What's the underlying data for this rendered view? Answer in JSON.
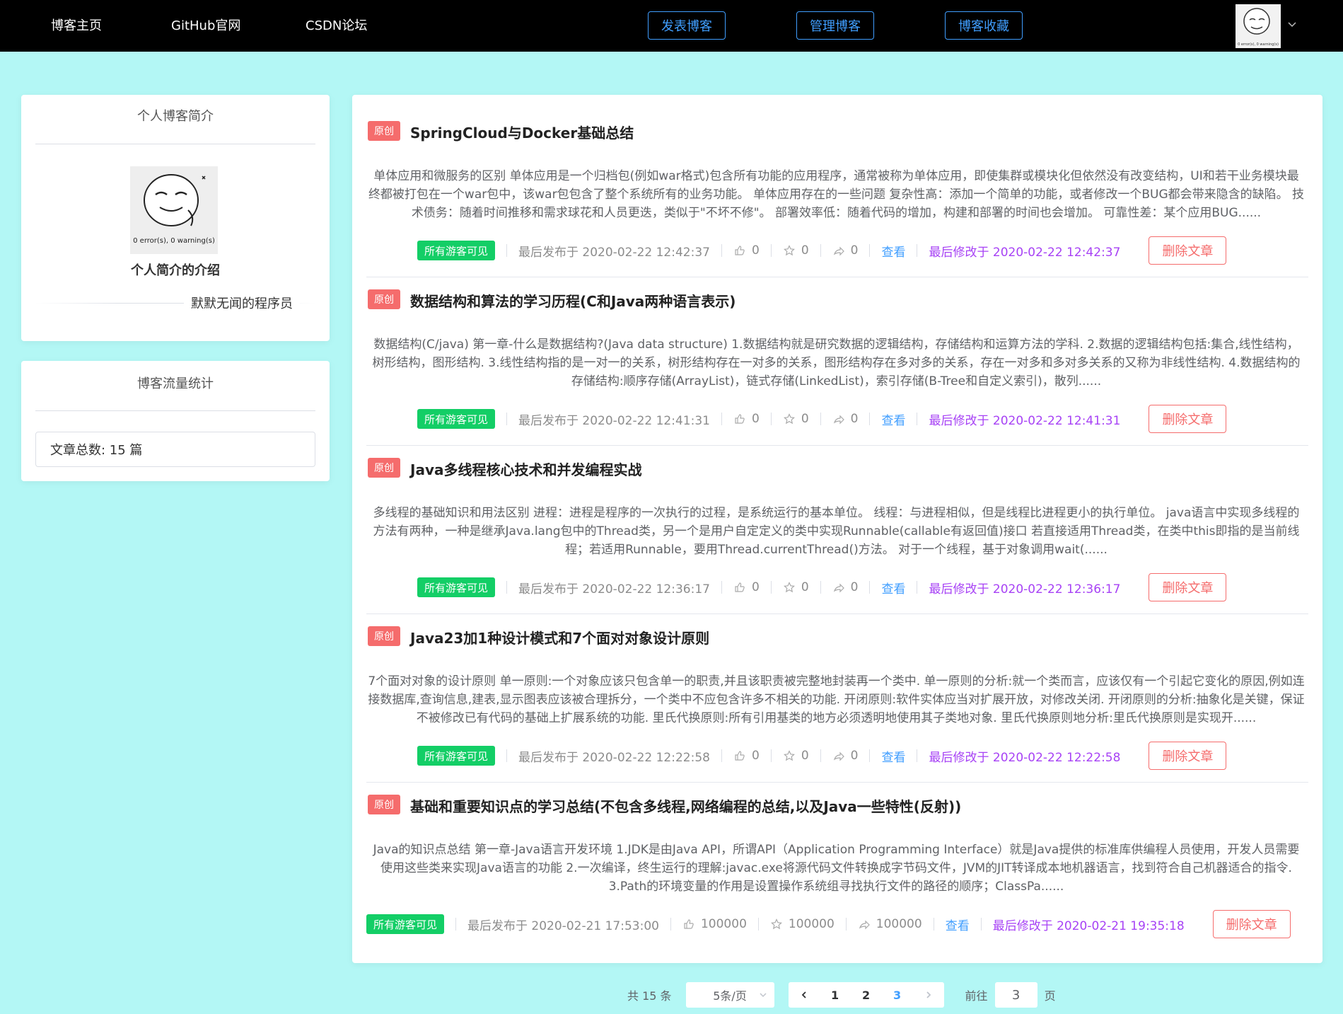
{
  "nav": {
    "home": "博客主页",
    "github": "GitHub官网",
    "csdn": "CSDN论坛",
    "publish": "发表博客",
    "manage": "管理博客",
    "favorites": "博客收藏"
  },
  "sidebar": {
    "profile_title": "个人博客简介",
    "avatar_caption": "0 error(s), 0 warning(s)",
    "profile_heading": "个人简介的介绍",
    "profile_name": "默默无闻的程序员",
    "stats_title": "博客流量统计",
    "article_count": "文章总数: 15 篇"
  },
  "articles": [
    {
      "badge": "原创",
      "title": "SpringCloud与Docker基础总结",
      "summary": "单体应用和微服务的区别 单体应用是一个归档包(例如war格式)包含所有功能的应用程序，通常被称为单体应用，即使集群或模块化但依然没有改变结构，UI和若干业务模块最终都被打包在一个war包中，该war包包含了整个系统所有的业务功能。 单体应用存在的一些问题 复杂性高：添加一个简单的功能，或者修改一个BUG都会带来隐含的缺陷。 技术债务：随着时间推移和需求球花和人员更迭，类似于\"不坏不修\"。 部署效率低：随着代码的增加，构建和部署的时间也会增加。 可靠性差：某个应用BUG......",
      "visibility": "所有游客可见",
      "published": "最后发布于 2020-02-22 12:42:37",
      "likes": "0",
      "stars": "0",
      "shares": "0",
      "view": "查看",
      "modified": "最后修改于 2020-02-22 12:42:37",
      "delete": "删除文章"
    },
    {
      "badge": "原创",
      "title": "数据结构和算法的学习历程(C和Java两种语言表示)",
      "summary": "数据结构(C/java) 第一章-什么是数据结构?(Java data structure) 1.数据结构就是研究数据的逻辑结构，存储结构和运算方法的学科. 2.数据的逻辑结构包括:集合,线性结构，树形结构，图形结构. 3.线性结构指的是一对一的关系，树形结构存在一对多的关系，图形结构存在多对多的关系，存在一对多和多对多关系的又称为非线性结构. 4.数据结构的存储结构:顺序存储(ArrayList)，链式存储(LinkedList)，索引存储(B-Tree和自定义索引)，散列......",
      "visibility": "所有游客可见",
      "published": "最后发布于 2020-02-22 12:41:31",
      "likes": "0",
      "stars": "0",
      "shares": "0",
      "view": "查看",
      "modified": "最后修改于 2020-02-22 12:41:31",
      "delete": "删除文章"
    },
    {
      "badge": "原创",
      "title": "Java多线程核心技术和并发编程实战",
      "summary": "多线程的基础知识和用法区别 进程：进程是程序的一次执行的过程，是系统运行的基本单位。 线程：与进程相似，但是线程比进程更小的执行单位。 java语言中实现多线程的方法有两种，一种是继承Java.lang包中的Thread类，另一个是用户自定定义的类中实现Runnable(callable有返回值)接口 若直接适用Thread类，在类中this即指的是当前线程；若适用Runnable，要用Thread.currentThread()方法。 对于一个线程，基于对象调用wait(......",
      "visibility": "所有游客可见",
      "published": "最后发布于 2020-02-22 12:36:17",
      "likes": "0",
      "stars": "0",
      "shares": "0",
      "view": "查看",
      "modified": "最后修改于 2020-02-22 12:36:17",
      "delete": "删除文章"
    },
    {
      "badge": "原创",
      "title": "Java23加1种设计模式和7个面对对象设计原则",
      "summary": "7个面对对象的设计原则 单一原则:一个对象应该只包含单一的职责,并且该职责被完整地封装再一个类中. 单一原则的分析:就一个类而言，应该仅有一个引起它变化的原因,例如连接数据库,查询信息,建表,显示图表应该被合理拆分，一个类中不应包含许多不相关的功能. 开闭原则:软件实体应当对扩展开放，对修改关闭. 开闭原则的分析:抽象化是关键，保证不被修改已有代码的基础上扩展系统的功能. 里氏代换原则:所有引用基类的地方必须透明地使用其子类地对象. 里氏代换原则地分析:里氏代换原则是实现开......",
      "visibility": "所有游客可见",
      "published": "最后发布于 2020-02-22 12:22:58",
      "likes": "0",
      "stars": "0",
      "shares": "0",
      "view": "查看",
      "modified": "最后修改于 2020-02-22 12:22:58",
      "delete": "删除文章"
    },
    {
      "badge": "原创",
      "title": "基础和重要知识点的学习总结(不包含多线程,网络编程的总结,以及Java一些特性(反射))",
      "summary": "Java的知识点总结 第一章-Java语言开发环境 1.JDK是由Java API，所谓API（Application Programming Interface）就是Java提供的标准库供编程人员使用，开发人员需要使用这些类来实现Java语言的功能 2.一次编译，终生运行的理解:javac.exe将源代码文件转换成字节码文件，JVM的JIT转译成本地机器语言，找到符合自己机器适合的指令. 3.Path的环境变量的作用是设置操作系统组寻找执行文件的路径的顺序；ClassPa......",
      "visibility": "所有游客可见",
      "published": "最后发布于 2020-02-21 17:53:00",
      "likes": "100000",
      "stars": "100000",
      "shares": "100000",
      "view": "查看",
      "modified": "最后修改于 2020-02-21 19:35:18",
      "delete": "删除文章"
    }
  ],
  "pager": {
    "total": "共 15 条",
    "page_size": "5条/页",
    "pages": [
      "1",
      "2",
      "3"
    ],
    "current": "3",
    "goto_prefix": "前往",
    "goto_value": "3",
    "goto_suffix": "页"
  },
  "colors": {
    "background": "#b3f7f5",
    "nav": "#000000",
    "accent": "#409eff",
    "danger": "#f56c6c",
    "success": "#13ce66",
    "modified": "#a742f5"
  }
}
